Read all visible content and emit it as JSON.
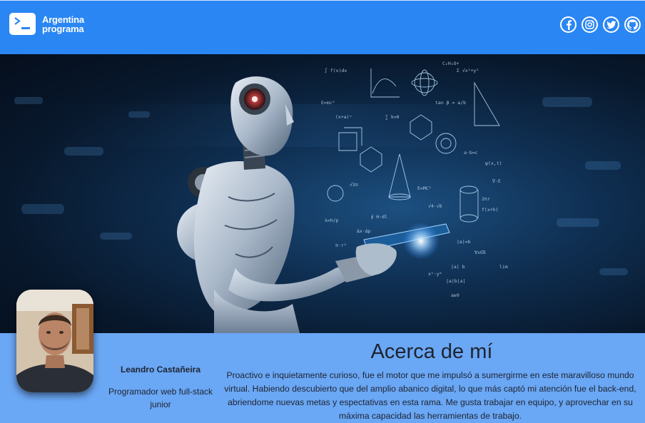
{
  "header": {
    "brand_line1": "Argentina",
    "brand_line2": "programa",
    "logo_icon": "terminal-icon",
    "socials": [
      {
        "icon": "facebook-icon"
      },
      {
        "icon": "instagram-icon"
      },
      {
        "icon": "twitter-icon"
      },
      {
        "icon": "github-icon"
      }
    ]
  },
  "hero": {
    "image": "robot-with-formulas-banner"
  },
  "profile": {
    "name": "Leandro Castañeira",
    "role": "Programador web full-stack junior"
  },
  "about": {
    "title": "Acerca de mí",
    "text": "Proactivo e inquietamente curioso, fue el motor que me impulsó a sumergirme en este maravilloso mundo virtual. Habiendo descubierto que del amplio abanico digital, lo que más captó mi atención fue el back-end, abriendome nuevas metas y espectativas en esta rama. Me gusta trabajar en equipo, y aprovechar en su máxima capacidad las herramientas de trabajo."
  },
  "colors": {
    "header_bg": "#2a86f3",
    "section_bg": "#6aa7f5",
    "text": "#1e2430"
  }
}
